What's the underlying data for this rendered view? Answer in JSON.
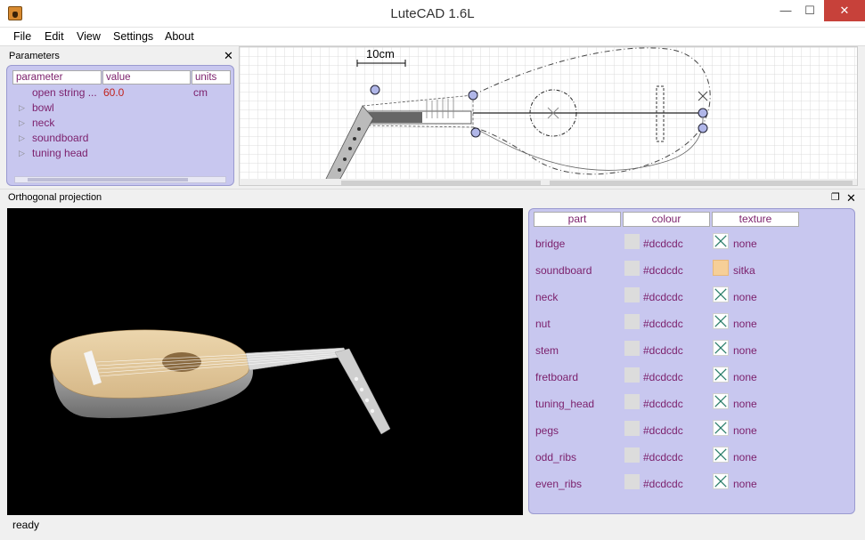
{
  "window": {
    "title": "LuteCAD 1.6L",
    "min_glyph": "—",
    "max_glyph": "☐",
    "close_glyph": "✕"
  },
  "menu": [
    "File",
    "Edit",
    "View",
    "Settings",
    "About"
  ],
  "parameters_panel": {
    "title": "Parameters",
    "close_glyph": "✕",
    "headers": {
      "parameter": "parameter",
      "value": "value",
      "units": "units"
    },
    "rows": [
      {
        "name": "open string ...",
        "value": "60.0",
        "units": "cm",
        "expandable": false
      },
      {
        "name": "bowl",
        "value": "",
        "units": "",
        "expandable": true
      },
      {
        "name": "neck",
        "value": "",
        "units": "",
        "expandable": true
      },
      {
        "name": "soundboard",
        "value": "",
        "units": "",
        "expandable": true
      },
      {
        "name": "tuning head",
        "value": "",
        "units": "",
        "expandable": true
      }
    ]
  },
  "drawing": {
    "scale_label": "10cm"
  },
  "ortho_panel": {
    "title": "Orthogonal projection",
    "float_glyph": "❐",
    "close_glyph": "✕"
  },
  "parts_table": {
    "headers": {
      "part": "part",
      "colour": "colour",
      "texture": "texture"
    },
    "rows": [
      {
        "part": "bridge",
        "colour": "#dcdcdc",
        "texture": "none"
      },
      {
        "part": "soundboard",
        "colour": "#dcdcdc",
        "texture": "sitka"
      },
      {
        "part": "neck",
        "colour": "#dcdcdc",
        "texture": "none"
      },
      {
        "part": "nut",
        "colour": "#dcdcdc",
        "texture": "none"
      },
      {
        "part": "stem",
        "colour": "#dcdcdc",
        "texture": "none"
      },
      {
        "part": "fretboard",
        "colour": "#dcdcdc",
        "texture": "none"
      },
      {
        "part": "tuning_head",
        "colour": "#dcdcdc",
        "texture": "none"
      },
      {
        "part": "pegs",
        "colour": "#dcdcdc",
        "texture": "none"
      },
      {
        "part": "odd_ribs",
        "colour": "#dcdcdc",
        "texture": "none"
      },
      {
        "part": "even_ribs",
        "colour": "#dcdcdc",
        "texture": "none"
      }
    ]
  },
  "status": "ready",
  "colors": {
    "panel_bg": "#c8c7ef",
    "label": "#7b1f6b",
    "value": "#c0231e",
    "close_button": "#c7413a"
  }
}
